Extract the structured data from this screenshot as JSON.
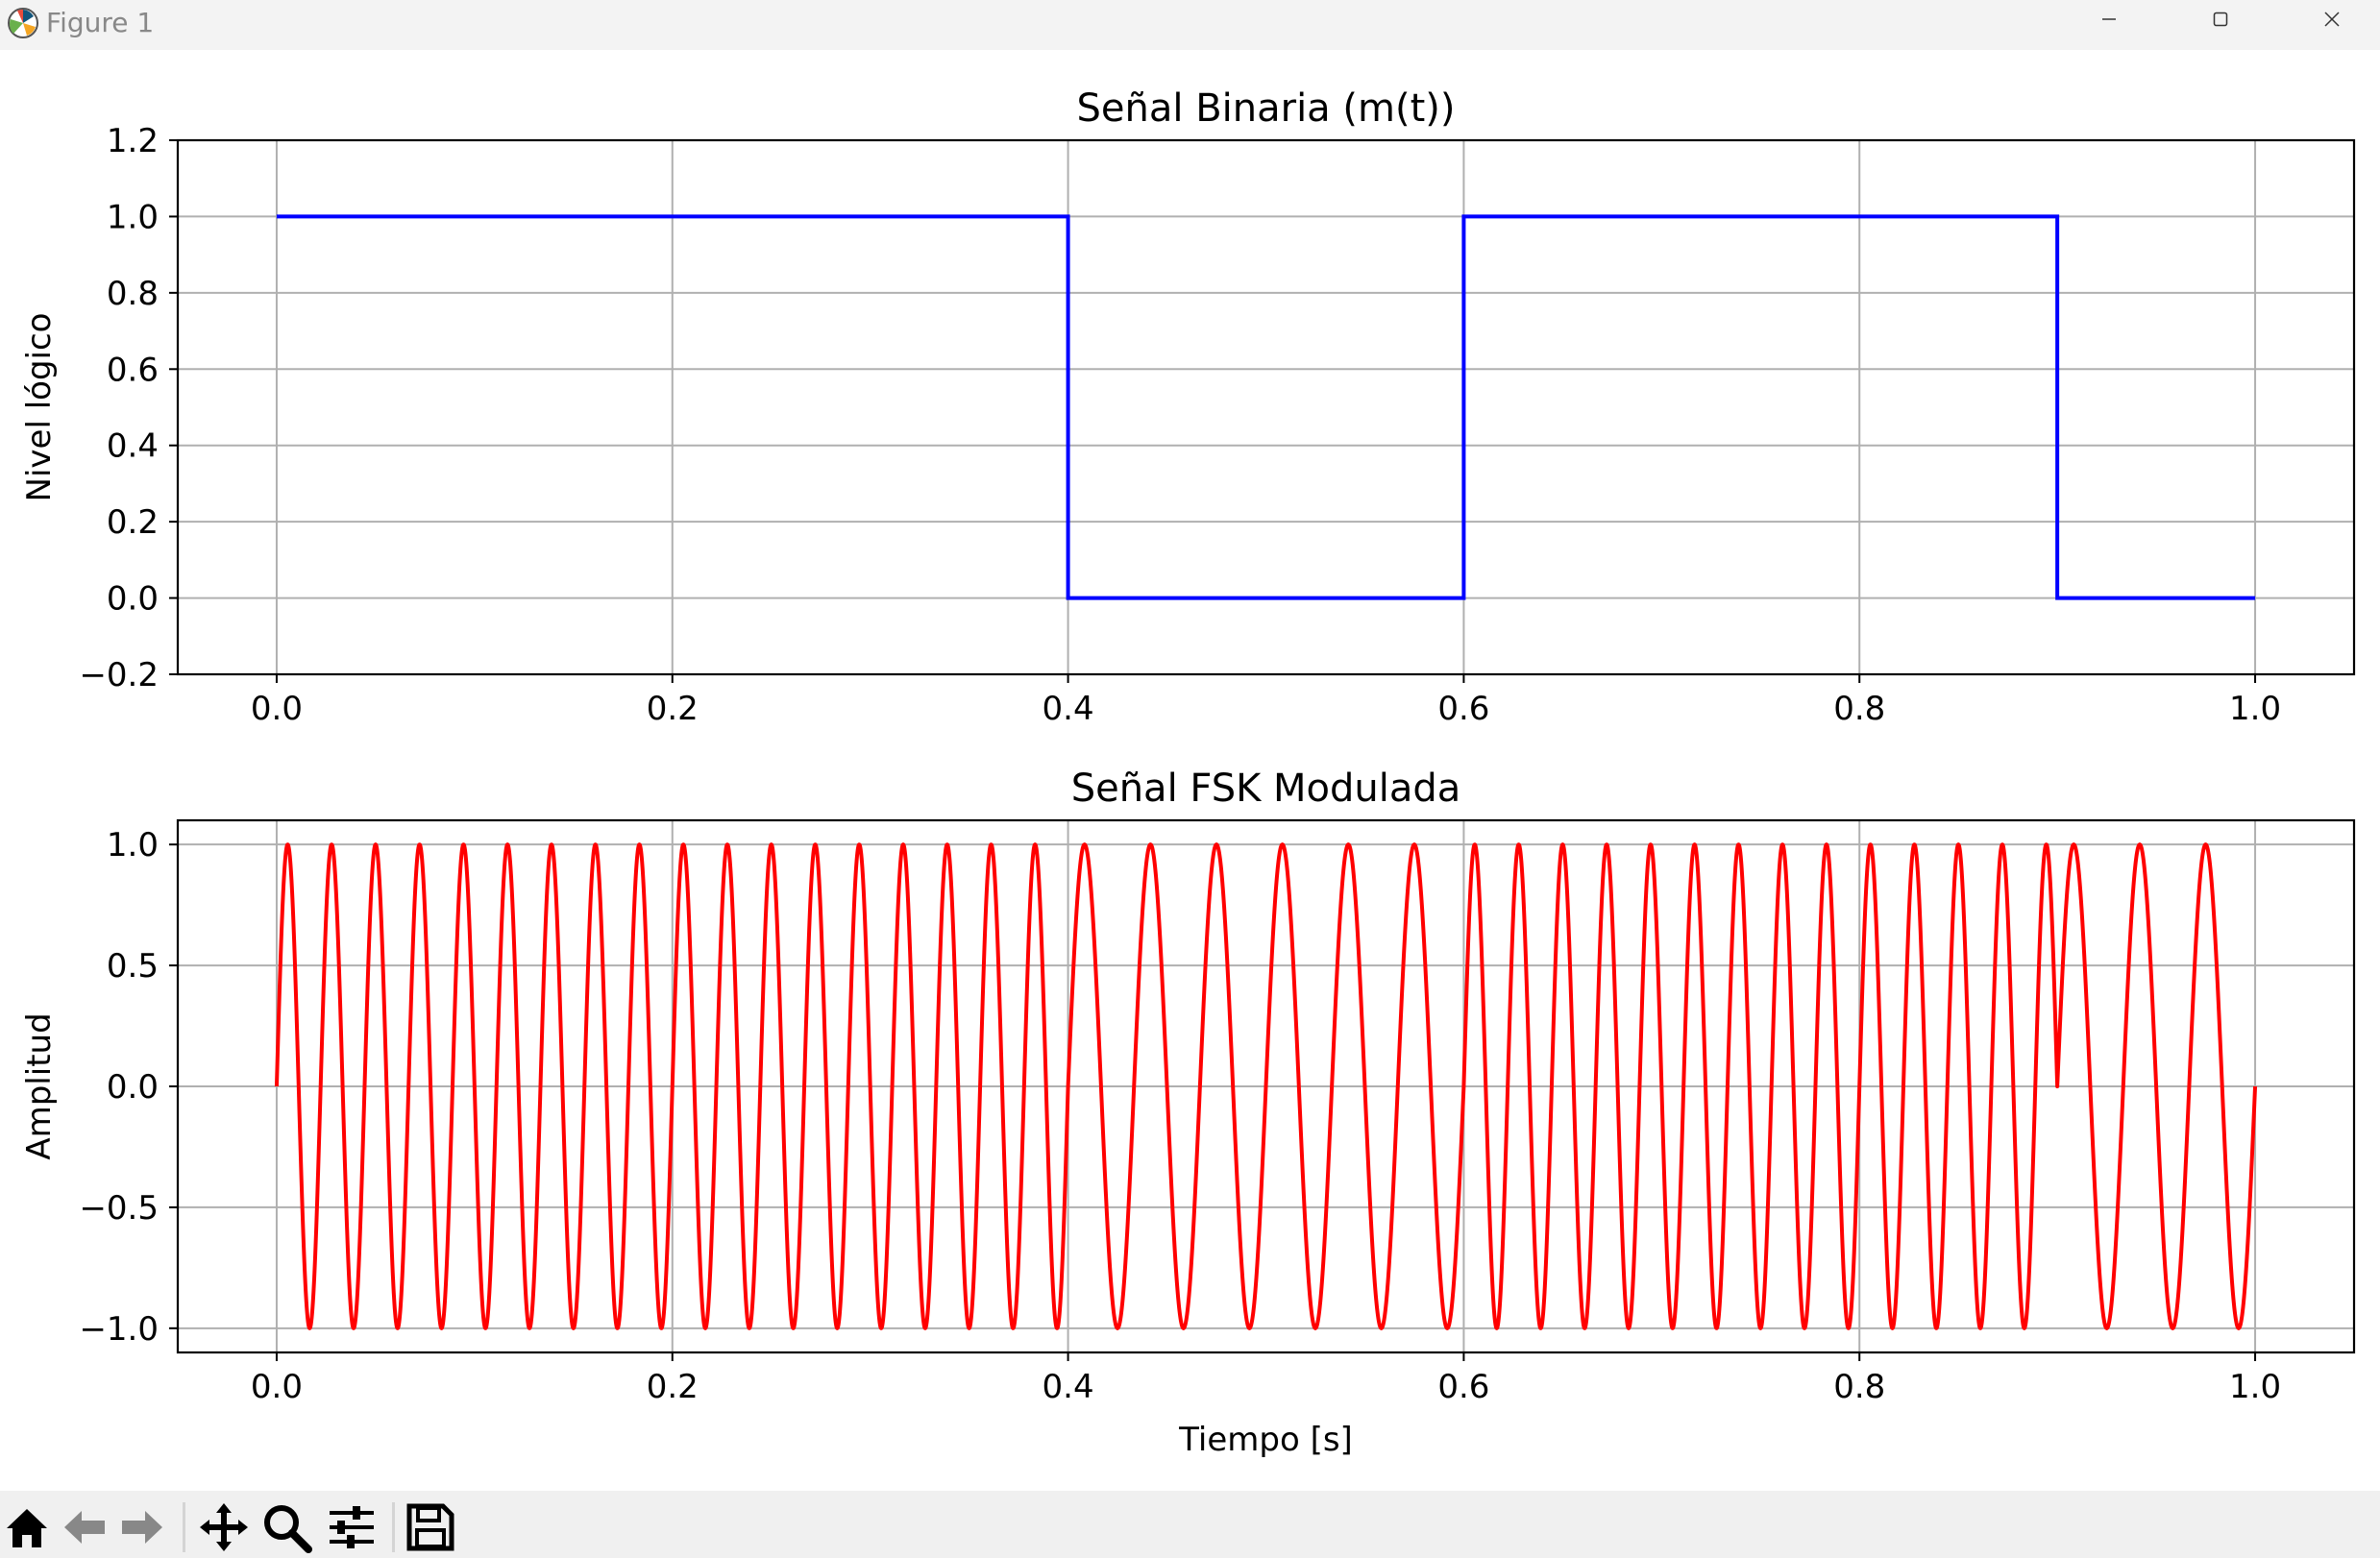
{
  "window": {
    "title": "Figure 1",
    "minimize_label": "Minimize",
    "maximize_label": "Maximize",
    "close_label": "Close"
  },
  "toolbar": {
    "items": [
      {
        "name": "home-button",
        "icon": "home-icon",
        "tooltip": "Reset original view"
      },
      {
        "name": "back-button",
        "icon": "arrow-left-icon",
        "tooltip": "Back to previous view"
      },
      {
        "name": "forward-button",
        "icon": "arrow-right-icon",
        "tooltip": "Forward to next view"
      },
      {
        "name": "pan-button",
        "icon": "move-icon",
        "tooltip": "Pan axes"
      },
      {
        "name": "zoom-button",
        "icon": "magnifier-icon",
        "tooltip": "Zoom to rectangle"
      },
      {
        "name": "configure-subplots-button",
        "icon": "sliders-icon",
        "tooltip": "Configure subplots"
      },
      {
        "name": "save-button",
        "icon": "floppy-disk-icon",
        "tooltip": "Save the figure"
      }
    ]
  },
  "chart_data": [
    {
      "type": "line",
      "title": "Señal Binaria (m(t))",
      "xlabel": "",
      "ylabel": "Nivel lógico",
      "xlim": [
        -0.05,
        1.05
      ],
      "ylim": [
        -0.2,
        1.2
      ],
      "xticks": [
        0.0,
        0.2,
        0.4,
        0.6,
        0.8,
        1.0
      ],
      "xtick_labels": [
        "0.0",
        "0.2",
        "0.4",
        "0.6",
        "0.8",
        "1.0"
      ],
      "yticks": [
        -0.2,
        0.0,
        0.2,
        0.4,
        0.6,
        0.8,
        1.0,
        1.2
      ],
      "ytick_labels": [
        "−0.2",
        "0.0",
        "0.2",
        "0.4",
        "0.6",
        "0.8",
        "1.0",
        "1.2"
      ],
      "grid": true,
      "color": "#0000ff",
      "series": [
        {
          "style": "step",
          "x": [
            0.0,
            0.4,
            0.4,
            0.6,
            0.6,
            0.9,
            0.9,
            1.0
          ],
          "values": [
            1,
            1,
            0,
            0,
            1,
            1,
            0,
            0
          ]
        }
      ]
    },
    {
      "type": "line",
      "title": "Señal FSK Modulada",
      "xlabel": "Tiempo [s]",
      "ylabel": "Amplitud",
      "xlim": [
        -0.05,
        1.05
      ],
      "ylim": [
        -1.1,
        1.1
      ],
      "xticks": [
        0.0,
        0.2,
        0.4,
        0.6,
        0.8,
        1.0
      ],
      "xtick_labels": [
        "0.0",
        "0.2",
        "0.4",
        "0.6",
        "0.8",
        "1.0"
      ],
      "yticks": [
        -1.0,
        -0.5,
        0.0,
        0.5,
        1.0
      ],
      "ytick_labels": [
        "−1.0",
        "−0.5",
        "0.0",
        "0.5",
        "1.0"
      ],
      "grid": true,
      "color": "#ff0000",
      "signal": "sin(2*pi*f*t)",
      "segments": [
        {
          "t_start": 0.0,
          "t_end": 0.4,
          "bit": 1,
          "frequency_hz": 45
        },
        {
          "t_start": 0.4,
          "t_end": 0.6,
          "bit": 0,
          "frequency_hz": 30
        },
        {
          "t_start": 0.6,
          "t_end": 0.9,
          "bit": 1,
          "frequency_hz": 45
        },
        {
          "t_start": 0.9,
          "t_end": 1.0,
          "bit": 0,
          "frequency_hz": 30
        }
      ]
    }
  ]
}
